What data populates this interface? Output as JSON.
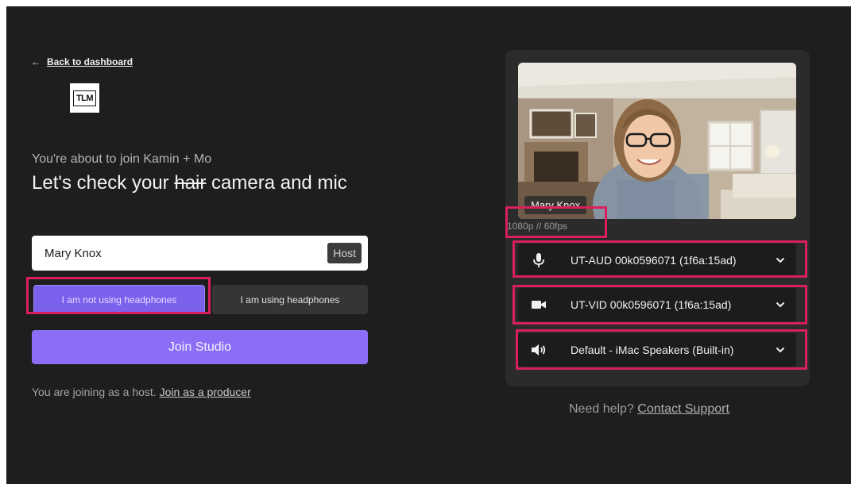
{
  "nav": {
    "back_label": "Back to dashboard"
  },
  "logo": {
    "text": "TLM"
  },
  "intro": {
    "subtitle": "You're about to join Kamin + Mo",
    "title_before": "Let's check your ",
    "title_struck": "hair",
    "title_after": " camera and mic"
  },
  "name_field": {
    "value": "Mary Knox",
    "badge": "Host"
  },
  "headphones": {
    "not_using_label": "I am not using headphones",
    "using_label": "I am using headphones",
    "selected": "not_using"
  },
  "join_button": {
    "label": "Join Studio"
  },
  "joining_note": {
    "text": "You are joining as a host. ",
    "link": "Join as a producer"
  },
  "preview": {
    "name_tag": "Mary Knox",
    "resolution": "1080p // 60fps"
  },
  "devices": [
    {
      "icon": "microphone-icon",
      "label": "UT-AUD 00k0596071 (1f6a:15ad)"
    },
    {
      "icon": "camera-icon",
      "label": "UT-VID 00k0596071 (1f6a:15ad)"
    },
    {
      "icon": "speaker-icon",
      "label": "Default - iMac Speakers (Built-in)"
    }
  ],
  "help": {
    "text": "Need help? ",
    "link": "Contact Support"
  },
  "colors": {
    "accent": "#8b6ef5",
    "highlight": "#d9205a",
    "background": "#1e1e1e"
  }
}
